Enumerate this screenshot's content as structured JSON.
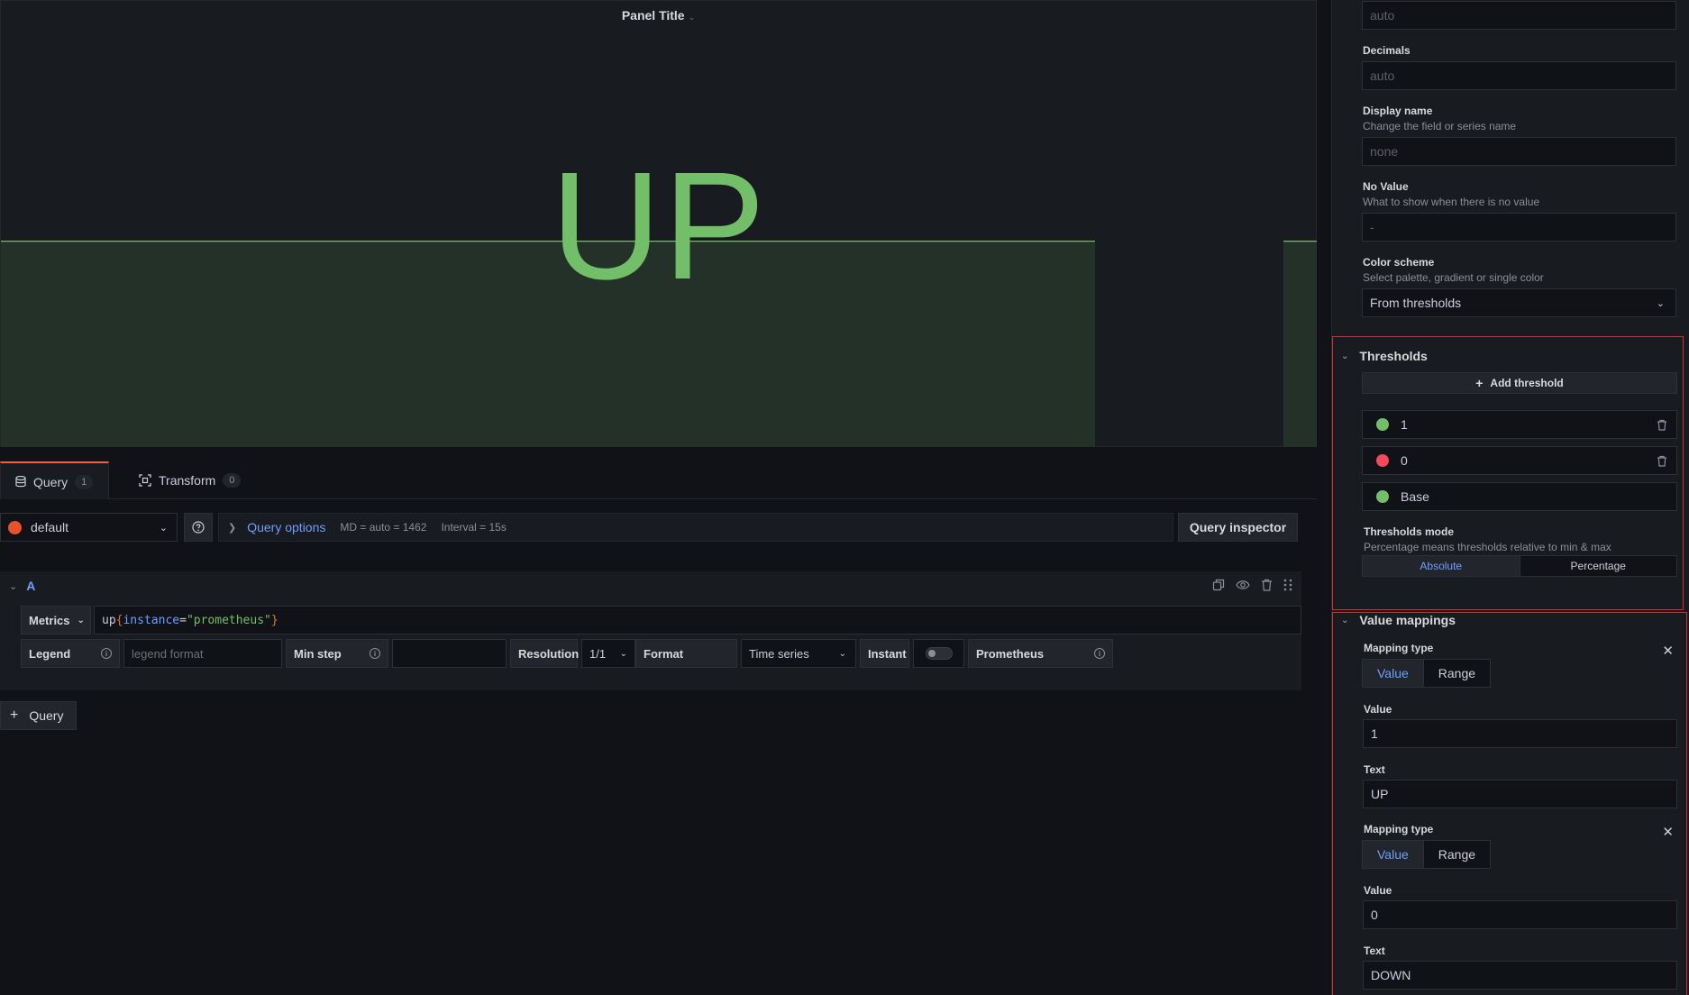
{
  "panel": {
    "title": "Panel Title",
    "value_text": "UP",
    "value_color": "#73bf69"
  },
  "tabs": [
    {
      "label": "Query",
      "count": "1",
      "active": true
    },
    {
      "label": "Transform",
      "count": "0",
      "active": false
    }
  ],
  "query_bar": {
    "datasource": "default",
    "options_label": "Query options",
    "md": "MD = auto = 1462",
    "interval": "Interval = 15s",
    "inspector_label": "Query inspector"
  },
  "query": {
    "ref_id": "A",
    "metrics_label": "Metrics",
    "expr_metric": "up",
    "expr_key": "instance",
    "expr_eq": "=",
    "expr_value": "\"prometheus\"",
    "legend_label": "Legend",
    "legend_placeholder": "legend format",
    "min_step_label": "Min step",
    "min_step_value": "",
    "resolution_label": "Resolution",
    "resolution_value": "1/1",
    "format_label": "Format",
    "format_value": "Time series",
    "instant_label": "Instant",
    "prometheus_label": "Prometheus"
  },
  "add_query_label": "Query",
  "options": {
    "top_input_placeholder": "auto",
    "decimals_label": "Decimals",
    "decimals_placeholder": "auto",
    "display_name_label": "Display name",
    "display_name_desc": "Change the field or series name",
    "display_name_placeholder": "none",
    "no_value_label": "No Value",
    "no_value_desc": "What to show when there is no value",
    "no_value_placeholder": "-",
    "color_scheme_label": "Color scheme",
    "color_scheme_desc": "Select palette, gradient or single color",
    "color_scheme_value": "From thresholds"
  },
  "thresholds": {
    "title": "Thresholds",
    "add_label": "Add threshold",
    "items": [
      {
        "value": "1",
        "color": "#73bf69"
      },
      {
        "value": "0",
        "color": "#f2495c"
      },
      {
        "value": "Base",
        "color": "#73bf69"
      }
    ],
    "mode_label": "Thresholds mode",
    "mode_desc": "Percentage means thresholds relative to min & max",
    "mode_options": [
      "Absolute",
      "Percentage"
    ],
    "mode_selected": "Absolute"
  },
  "value_mappings": {
    "title": "Value mappings",
    "mappings": [
      {
        "type_label": "Mapping type",
        "types": [
          "Value",
          "Range"
        ],
        "selected": "Value",
        "value_label": "Value",
        "value": "1",
        "text_label": "Text",
        "text": "UP"
      },
      {
        "type_label": "Mapping type",
        "types": [
          "Value",
          "Range"
        ],
        "selected": "Value",
        "value_label": "Value",
        "value": "0",
        "text_label": "Text",
        "text": "DOWN"
      }
    ]
  }
}
